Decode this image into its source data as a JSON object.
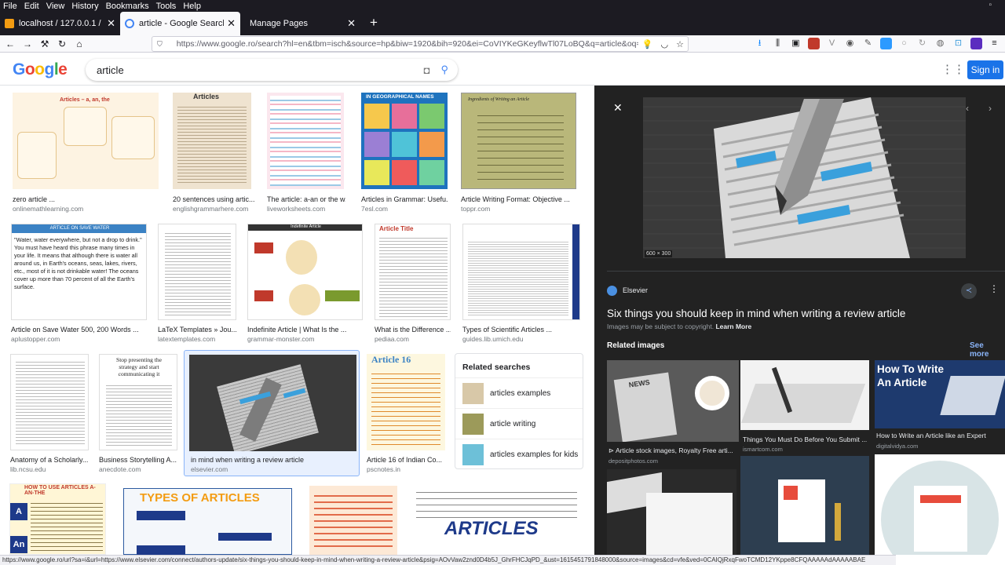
{
  "menubar": {
    "items": [
      "File",
      "Edit",
      "View",
      "History",
      "Bookmarks",
      "Tools",
      "Help"
    ]
  },
  "tabs": [
    {
      "label": "localhost / 127.0.0.1 / lrv8_site",
      "active": false
    },
    {
      "label": "article - Google Search",
      "active": true
    },
    {
      "label": "Manage Pages",
      "active": false
    }
  ],
  "url": "https://www.google.ro/search?hl=en&tbm=isch&source=hp&biw=1920&bih=920&ei=CoVIYKeGKeyflwTl07LoBQ&q=article&oq=article",
  "search": {
    "query": "article",
    "signin": "Sign in"
  },
  "results": [
    {
      "caption": "zero article ...",
      "source": "onlinemathlearning.com"
    },
    {
      "caption": "20 sentences using artic...",
      "source": "englishgrammarhere.com"
    },
    {
      "caption": "The article: a-an or the w...",
      "source": "liveworksheets.com"
    },
    {
      "caption": "Articles in Grammar: Usefu...",
      "source": "7esl.com"
    },
    {
      "caption": "Article Writing Format: Objective ...",
      "source": "toppr.com"
    },
    {
      "caption": "Article on Save Water 500, 200 Words ...",
      "source": "aplustopper.com"
    },
    {
      "caption": "LaTeX Templates » Jou...",
      "source": "latextemplates.com"
    },
    {
      "caption": "Indefinite Article | What Is the ...",
      "source": "grammar-monster.com"
    },
    {
      "caption": "What is the Difference ...",
      "source": "pediaa.com"
    },
    {
      "caption": "Types of Scientific Articles ...",
      "source": "guides.lib.umich.edu"
    },
    {
      "caption": "Anatomy of a Scholarly...",
      "source": "lib.ncsu.edu"
    },
    {
      "caption": "Business Storytelling A...",
      "source": "anecdote.com"
    },
    {
      "caption": "in mind when writing a review article",
      "source": "elsevier.com"
    },
    {
      "caption": "Article 16 of Indian Co...",
      "source": "pscnotes.in"
    }
  ],
  "thumbtext": {
    "t1": "Articles – a, an, the",
    "t2": "Articles",
    "t4": "IN GEOGRAPHICAL NAMES",
    "t5": "Ingredients of Writing an Article",
    "t6h": "ARTICLE ON SAVE WATER",
    "t6": "\"Water, water everywhere, but not a drop to drink.\" You must have heard this phrase many times in your life. It means that although there is water all around us, in Earth's oceans, seas, lakes, rivers, etc., most of it is not drinkable water! The oceans cover up more than 70 percent of all the Earth's surface.",
    "t8": "Indefinite Article",
    "t9": "Article Title",
    "t12": "Stop presenting the strategy and start communicating it",
    "t14": "Article 16",
    "b1": "HOW TO USE ARTICLES A-AN-THE",
    "b2": "TYPES OF ARTICLES",
    "b4": "ARTICLES"
  },
  "related_searches": {
    "heading": "Related searches",
    "items": [
      "articles examples",
      "article writing",
      "articles examples for kids"
    ]
  },
  "panel": {
    "dims": "600 × 300",
    "source": "Elsevier",
    "title": "Six things you should keep in mind when writing a review article",
    "copyright": "Images may be subject to copyright.",
    "learn_more": "Learn More",
    "related": "Related images",
    "see_more": "See more",
    "related_items": [
      {
        "caption": "⊳ Article stock images, Royalty Free arti...",
        "source": "depositphotos.com"
      },
      {
        "caption": "Things You Must Do Before You Submit ...",
        "source": "ismartcom.com"
      },
      {
        "caption": "How to Write an Article like an Expert",
        "source": "digitalvidya.com"
      }
    ],
    "how_to": "How To Write An Article",
    "news": "NEWS"
  },
  "status": "https://www.google.ro/url?sa=i&url=https://www.elsevier.com/connect/authors-update/six-things-you-should-keep-in-mind-when-writing-a-review-article&psig=AOvVaw2znd0D4b5J_GhrFHCJqPD_&ust=1615451791848000&source=images&cd=vfe&ved=0CAIQjRxqFwoTCMD12YKppe8CFQAAAAAdAAAAABAE"
}
